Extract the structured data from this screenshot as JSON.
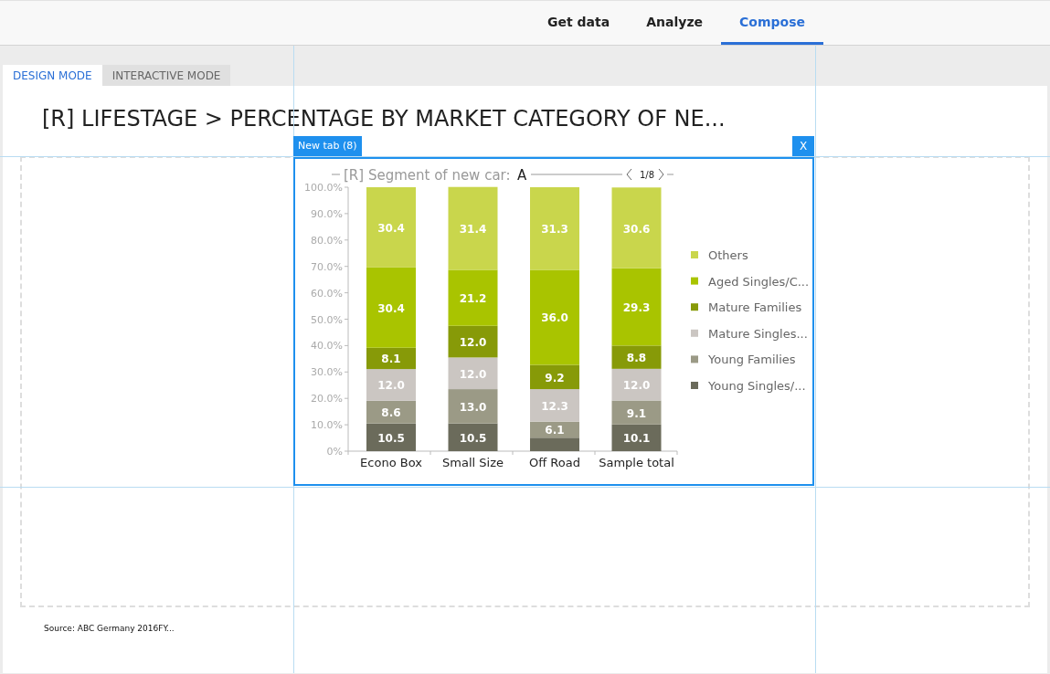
{
  "nav": {
    "tabs": [
      {
        "label": "Get data",
        "selected": false
      },
      {
        "label": "Analyze",
        "selected": false
      },
      {
        "label": "Compose",
        "selected": true
      }
    ]
  },
  "mode_tabs": [
    {
      "label": "DESIGN MODE",
      "selected": true
    },
    {
      "label": "INTERACTIVE MODE",
      "selected": false
    }
  ],
  "page_title": "[R] LIFESTAGE > PERCENTAGE BY MARKET CATEGORY OF NE...",
  "widget": {
    "tab_label": "New tab (8)",
    "close_label": "X",
    "chart_title": "[R] Segment of new car:",
    "filter_value": "A",
    "pager": "1/8",
    "chart_data": {
      "type": "bar",
      "stacked": true,
      "legend": "right",
      "value_labels": [
        [
          "10.5",
          "10.5",
          null,
          "10.1"
        ],
        [
          "8.6",
          "13.0",
          "6.1",
          "9.1"
        ],
        [
          "12.0",
          "12.0",
          "12.3",
          "12.0"
        ],
        [
          "8.1",
          "12.0",
          "9.2",
          "8.8"
        ],
        [
          "30.4",
          "21.2",
          "36.0",
          "29.3"
        ],
        [
          "30.4",
          "31.4",
          "31.3",
          "30.6"
        ]
      ],
      "categories": [
        "Econo Box",
        "Small Size",
        "Off Road",
        "Sample total"
      ],
      "ylim": [
        0,
        100
      ],
      "yticks": [
        {
          "value": 0,
          "label": "0%"
        },
        {
          "value": 10,
          "label": "10.0%"
        },
        {
          "value": 20,
          "label": "20.0%"
        },
        {
          "value": 30,
          "label": "30.0%"
        },
        {
          "value": 40,
          "label": "40.0%"
        },
        {
          "value": 50,
          "label": "50.0%"
        },
        {
          "value": 60,
          "label": "60.0%"
        },
        {
          "value": 70,
          "label": "70.0%"
        },
        {
          "value": 80,
          "label": "80.0%"
        },
        {
          "value": 90,
          "label": "90.0%"
        },
        {
          "value": 100,
          "label": "100.0%"
        }
      ],
      "series": [
        {
          "name": "Young Singles/...",
          "color": "#6b6b5b",
          "values": [
            10.5,
            10.5,
            5.1,
            10.1
          ]
        },
        {
          "name": "Young Families",
          "color": "#9b9a86",
          "values": [
            8.6,
            13.0,
            6.1,
            9.1
          ]
        },
        {
          "name": "Mature Singles...",
          "color": "#cbc6c2",
          "values": [
            12.0,
            12.0,
            12.3,
            12.0
          ]
        },
        {
          "name": "Mature Families",
          "color": "#879a08",
          "values": [
            8.1,
            12.0,
            9.2,
            8.8
          ]
        },
        {
          "name": "Aged Singles/C...",
          "color": "#a9c400",
          "values": [
            30.4,
            21.2,
            36.0,
            29.3
          ]
        },
        {
          "name": "Others",
          "color": "#c9d64c",
          "values": [
            30.4,
            31.4,
            31.3,
            30.6
          ]
        }
      ]
    }
  },
  "source": "Source: ABC Germany 2016FY..."
}
